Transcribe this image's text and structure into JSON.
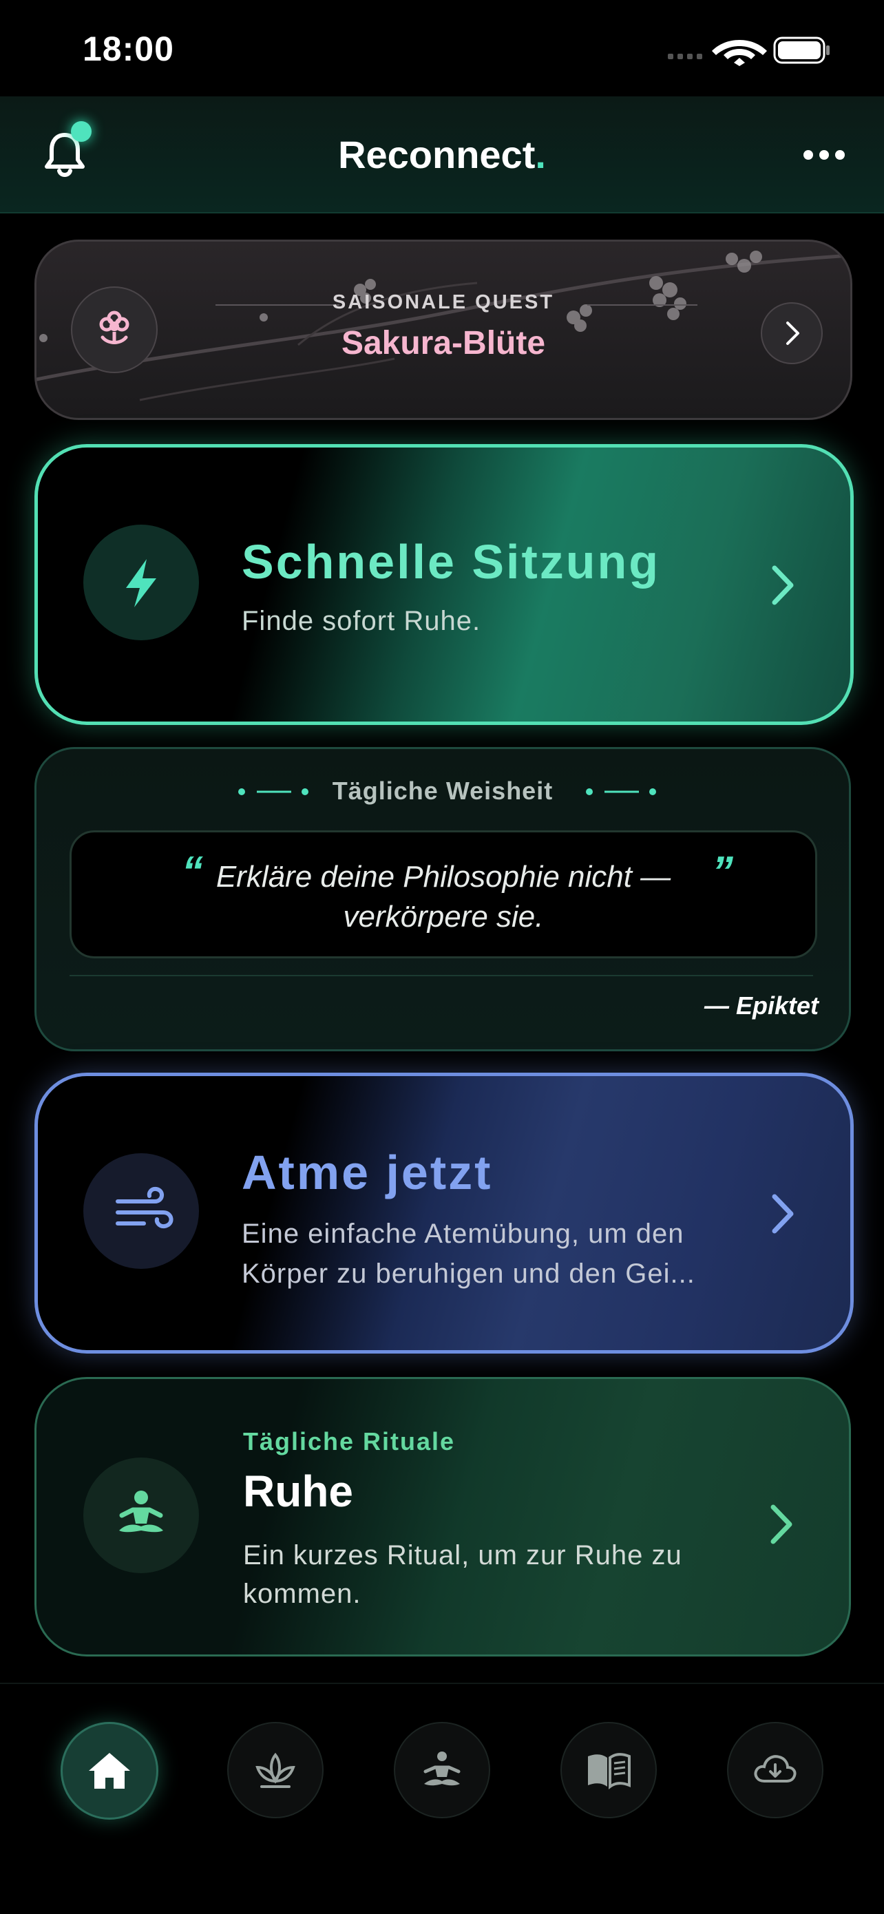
{
  "status_bar": {
    "time": "18:00"
  },
  "header": {
    "title": "Reconnect",
    "title_dot": "."
  },
  "seasonal_quest": {
    "label": "SAISONALE QUEST",
    "title": "Sakura-Blüte"
  },
  "quick_session": {
    "title": "Schnelle Sitzung",
    "subtitle": "Finde sofort Ruhe."
  },
  "daily_wisdom": {
    "heading": "Tägliche Weisheit",
    "quote_open": "“",
    "quote": "Erkläre deine Philosophie nicht — verkörpere sie.",
    "quote_close": "”",
    "author": "— Epiktet"
  },
  "breathe": {
    "title": "Atme jetzt",
    "subtitle": "Eine einfache Atemübung, um den Körper zu beruhigen und den Gei..."
  },
  "ritual": {
    "label": "Tägliche Rituale",
    "title": "Ruhe",
    "subtitle": "Ein kurzes Ritual, um zur Ruhe zu kommen."
  },
  "tabs": [
    {
      "icon": "home-icon",
      "active": true
    },
    {
      "icon": "lotus-icon",
      "active": false
    },
    {
      "icon": "meditation-icon",
      "active": false
    },
    {
      "icon": "book-icon",
      "active": false
    },
    {
      "icon": "cloud-download-icon",
      "active": false
    }
  ],
  "colors": {
    "accent_teal": "#4fe3bd",
    "quick_border": "#53e0b4",
    "breathe_border": "#6e8ee0",
    "ritual_accent": "#64d9a0",
    "quest_title": "#f6b6cf"
  }
}
